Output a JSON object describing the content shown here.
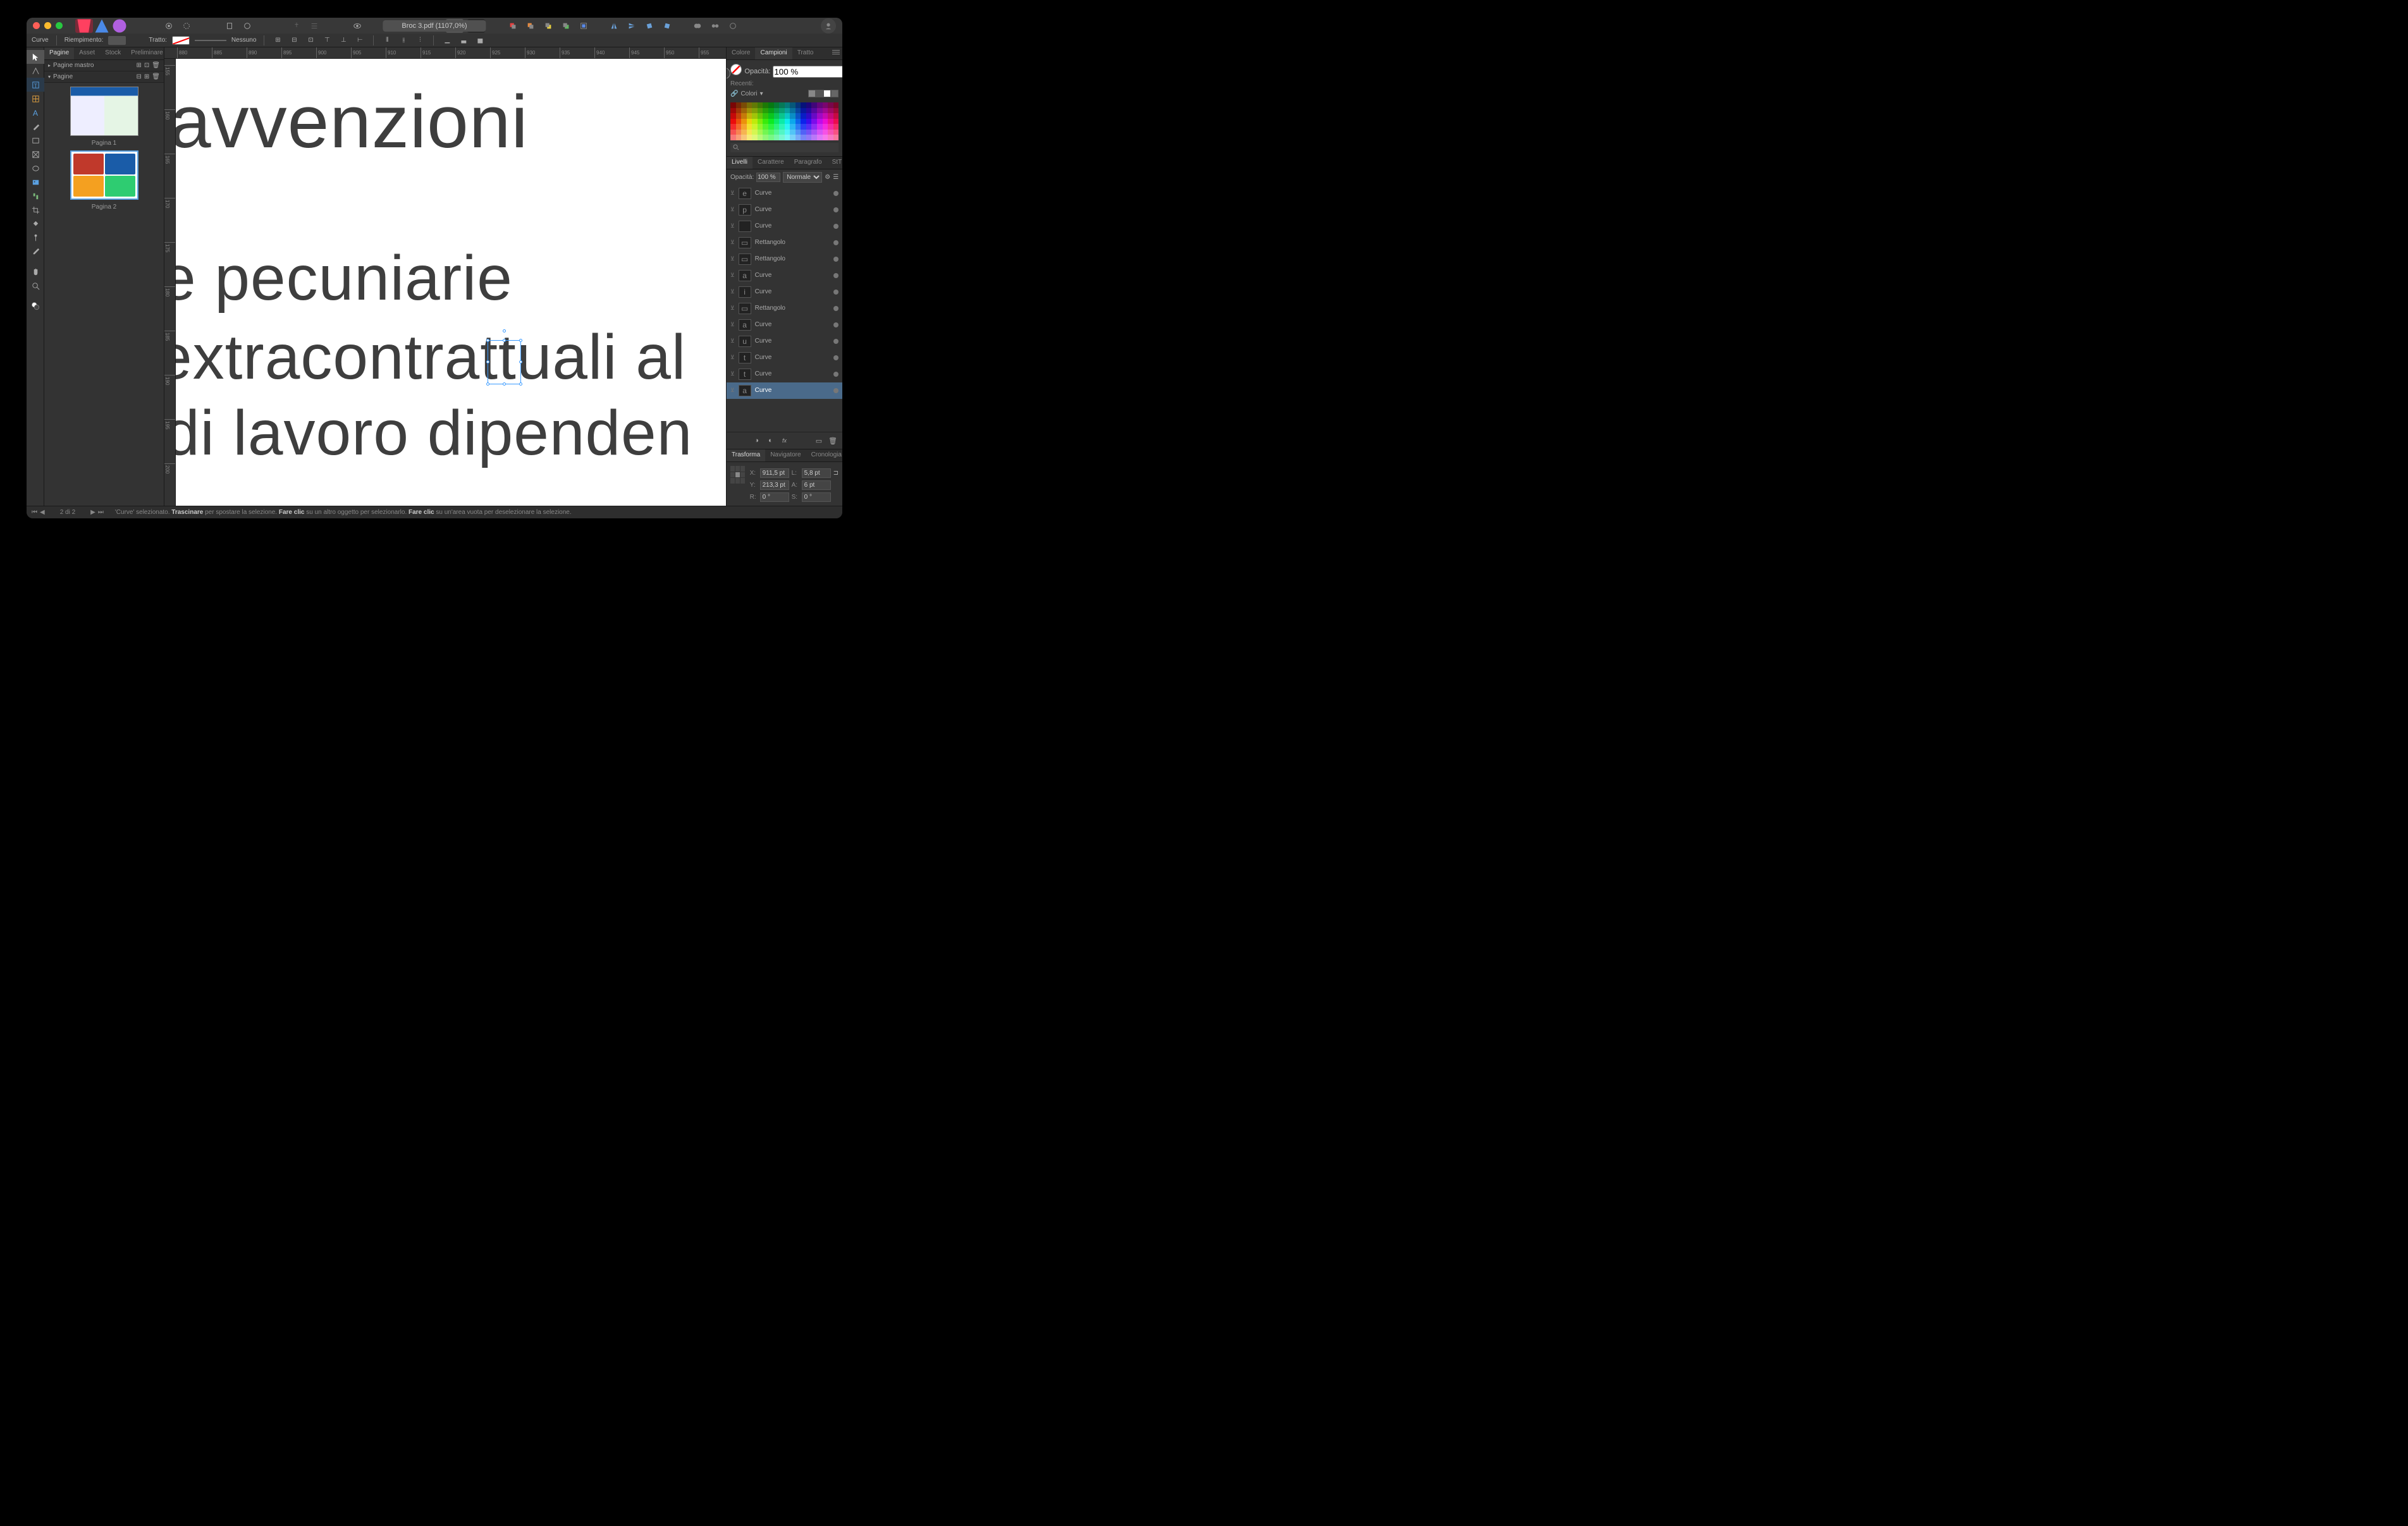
{
  "title": "Broc 3.pdf (1107,0%)",
  "context": {
    "object_type": "Curve",
    "fill_label": "Riempimento:",
    "stroke_label": "Tratto:",
    "stroke_value": "Nessuno"
  },
  "left_tabs": [
    "Pagine",
    "Asset",
    "Stock",
    "Preliminare"
  ],
  "left_active_tab": 0,
  "master_pages_label": "Pagine mastro",
  "pages_label": "Pagine",
  "page_thumbs": [
    {
      "label": "Pagina 1"
    },
    {
      "label": "Pagina 2"
    }
  ],
  "ruler_h_ticks": [
    "880",
    "885",
    "890",
    "895",
    "900",
    "905",
    "910",
    "915",
    "920",
    "925",
    "930",
    "935",
    "940",
    "945",
    "950",
    "955"
  ],
  "ruler_v_ticks": [
    "155",
    "160",
    "165",
    "170",
    "175",
    "180",
    "185",
    "190",
    "195",
    "200"
  ],
  "canvas_text": {
    "line1": "avvenzioni",
    "line2": "e pecuniarie",
    "line3": "  extracontrattuali al",
    "line4": " di lavoro dipenden"
  },
  "right_color_tabs": [
    "Colore",
    "Campioni",
    "Tratto"
  ],
  "right_color_active": 1,
  "opacity_label": "Opacità:",
  "opacity_value": "100 %",
  "recents_label": "Recenti:",
  "swatch_category": "Colori",
  "swatch_search_placeholder": "",
  "right_layers_tabs": [
    "Livelli",
    "Carattere",
    "Paragrafo",
    "StT"
  ],
  "right_layers_active": 0,
  "layers_opacity_label": "Opacità:",
  "layers_opacity_value": "100 %",
  "blend_mode": "Normale",
  "layers": [
    {
      "glyph": "e",
      "name": "Curve"
    },
    {
      "glyph": "p",
      "name": "Curve"
    },
    {
      "glyph": " ",
      "name": "Curve"
    },
    {
      "glyph": "▭",
      "name": "Rettangolo"
    },
    {
      "glyph": "▭",
      "name": "Rettangolo"
    },
    {
      "glyph": "a",
      "name": "Curve"
    },
    {
      "glyph": "i",
      "name": "Curve"
    },
    {
      "glyph": "▭",
      "name": "Rettangolo"
    },
    {
      "glyph": "a",
      "name": "Curve"
    },
    {
      "glyph": "u",
      "name": "Curve"
    },
    {
      "glyph": "t",
      "name": "Curve"
    },
    {
      "glyph": "t",
      "name": "Curve"
    },
    {
      "glyph": "a",
      "name": "Curve",
      "selected": true
    }
  ],
  "right_transform_tabs": [
    "Trasforma",
    "Navigatore",
    "Cronologia"
  ],
  "right_transform_active": 0,
  "transform": {
    "x_label": "X:",
    "x": "911,5 pt",
    "y_label": "Y:",
    "y": "213,3 pt",
    "w_label": "L:",
    "w": "5,8 pt",
    "h_label": "A:",
    "h": "6 pt",
    "r_label": "R:",
    "r": "0 °",
    "s_label": "S:",
    "s": "0 °"
  },
  "status": {
    "page_indicator": "2 di 2",
    "hint_object": "'Curve' selezionato.",
    "hint_drag_bold": "Trascinare",
    "hint_drag": " per spostare la selezione. ",
    "hint_click1_bold": "Fare clic",
    "hint_click1": " su un altro oggetto per selezionarlo. ",
    "hint_click2_bold": "Fare clic",
    "hint_click2": " su un'area vuota per deselezionare la selezione."
  }
}
